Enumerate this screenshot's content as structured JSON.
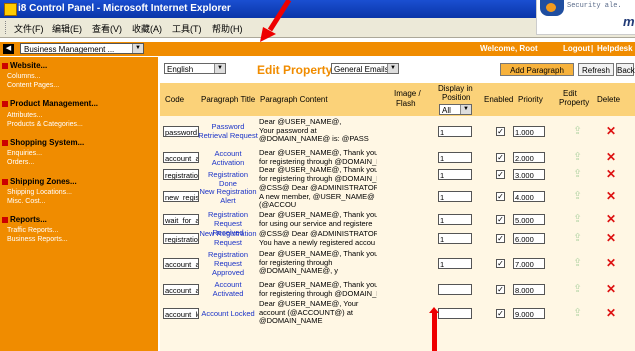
{
  "window": {
    "title": "i8 Control Panel - Microsoft Internet Explorer"
  },
  "menu": [
    "文件(F)",
    "编辑(E)",
    "查看(V)",
    "收藏(A)",
    "工具(T)",
    "帮助(H)"
  ],
  "security_panel": {
    "text": "Security ale."
  },
  "topbar": {
    "site_select": "Business Management ...",
    "welcome": "Welcome, Root",
    "logout": "Logout",
    "separator": "|",
    "helpdesk": "Helpdesk"
  },
  "sidebar": {
    "sections": [
      {
        "title": "Website...",
        "items": [
          "Columns...",
          "Content Pages..."
        ]
      },
      {
        "title": "Product Management...",
        "items": [
          "Attributes...",
          "Products & Categories..."
        ]
      },
      {
        "title": "Shopping System...",
        "items": [
          "Enquiries...",
          "Orders..."
        ]
      },
      {
        "title": "Shipping Zones...",
        "items": [
          "Shipping Locations...",
          "Misc. Cost..."
        ]
      },
      {
        "title": "Reports...",
        "items": [
          "Traffic Reports...",
          "Business Reports..."
        ]
      }
    ]
  },
  "toolbar": {
    "language": "English",
    "edit_property_label": "Edit Property:",
    "property_select": "General Emails (9)",
    "add_paragraph": "Add Paragraph",
    "refresh": "Refresh",
    "back": "Back"
  },
  "table": {
    "headers": {
      "code": "Code",
      "title": "Paragraph Title",
      "content": "Paragraph Content",
      "image": "Image /",
      "flash": "Flash",
      "position_1": "Display in",
      "position_2": "Position",
      "position_filter": "All",
      "enabled": "Enabled",
      "priority": "Priority",
      "edit_1": "Edit",
      "edit_2": "Property",
      "delete": "Delete"
    },
    "rows": [
      {
        "code": "password",
        "title": [
          "Password",
          "Retrieval Request"
        ],
        "content": [
          "Dear @USER_NAME@,",
          "     Your password at",
          "@DOMAIN_NAME@ is: @PASS"
        ],
        "position": "1",
        "enabled": true,
        "priority": "1.000"
      },
      {
        "code": "account_a",
        "title": [
          "Account",
          "Activation"
        ],
        "content": [
          "Dear @USER_NAME@,        Thank you",
          "for registering through @DOMAIN_NAM"
        ],
        "position": "1",
        "enabled": true,
        "priority": "2.000"
      },
      {
        "code": "registratio",
        "title": [
          "Registration Done"
        ],
        "content": [
          "Dear @USER_NAME@,        Thank you",
          "for registering through @DOMAIN_NAM"
        ],
        "position": "1",
        "enabled": true,
        "priority": "3.000"
      },
      {
        "code": "new_regis",
        "title": [
          "New Registration",
          "Alert"
        ],
        "content": [
          "@CSS@ Dear @ADMINISTRATOR@,",
          "     A new member, @USER_NAME@",
          "(@ACCOU"
        ],
        "position": "1",
        "enabled": true,
        "priority": "4.000"
      },
      {
        "code": "wait_for_a",
        "title": [
          "Registration",
          "Request Received"
        ],
        "content": [
          "Dear @USER_NAME@,        Thank you",
          "for using our service and registere"
        ],
        "position": "1",
        "enabled": true,
        "priority": "5.000"
      },
      {
        "code": "registratio",
        "title": [
          "New Registration",
          "Request"
        ],
        "content": [
          "@CSS@ Dear @ADMINISTRATOR@,",
          "     You have a newly registered accou"
        ],
        "position": "1",
        "enabled": true,
        "priority": "6.000"
      },
      {
        "code": "account_a",
        "title": [
          "Registration",
          "Request",
          "Approved"
        ],
        "content": [
          "Dear @USER_NAME@,        Thank you",
          "for registering through",
          "@DOMAIN_NAME@, y"
        ],
        "position": "1",
        "enabled": true,
        "priority": "7.000"
      },
      {
        "code": "account_a",
        "title": [
          "Account",
          "Activated"
        ],
        "content": [
          "Dear @USER_NAME@,        Thank you",
          "for registering through @DOMAIN_NAM"
        ],
        "position": "",
        "enabled": true,
        "priority": "8.000"
      },
      {
        "code": "account_lo",
        "title": [
          "Account Locked"
        ],
        "content": [
          "Dear @USER_NAME@,        Your",
          "account (@ACCOUNT@) at",
          "@DOMAIN_NAME"
        ],
        "position": "",
        "enabled": true,
        "priority": "9.000"
      }
    ]
  },
  "colors": {
    "orange": "#f08c00",
    "header_band": "#fbd279",
    "row_bg": "#fff7e4",
    "link_blue": "#1b33c8",
    "delete_red": "#dd1111",
    "arrow_red": "#ee0000"
  },
  "icons": {
    "edit": "edit-property-icon",
    "delete": "delete-x-icon",
    "dropdown": "chevron-down-icon"
  }
}
